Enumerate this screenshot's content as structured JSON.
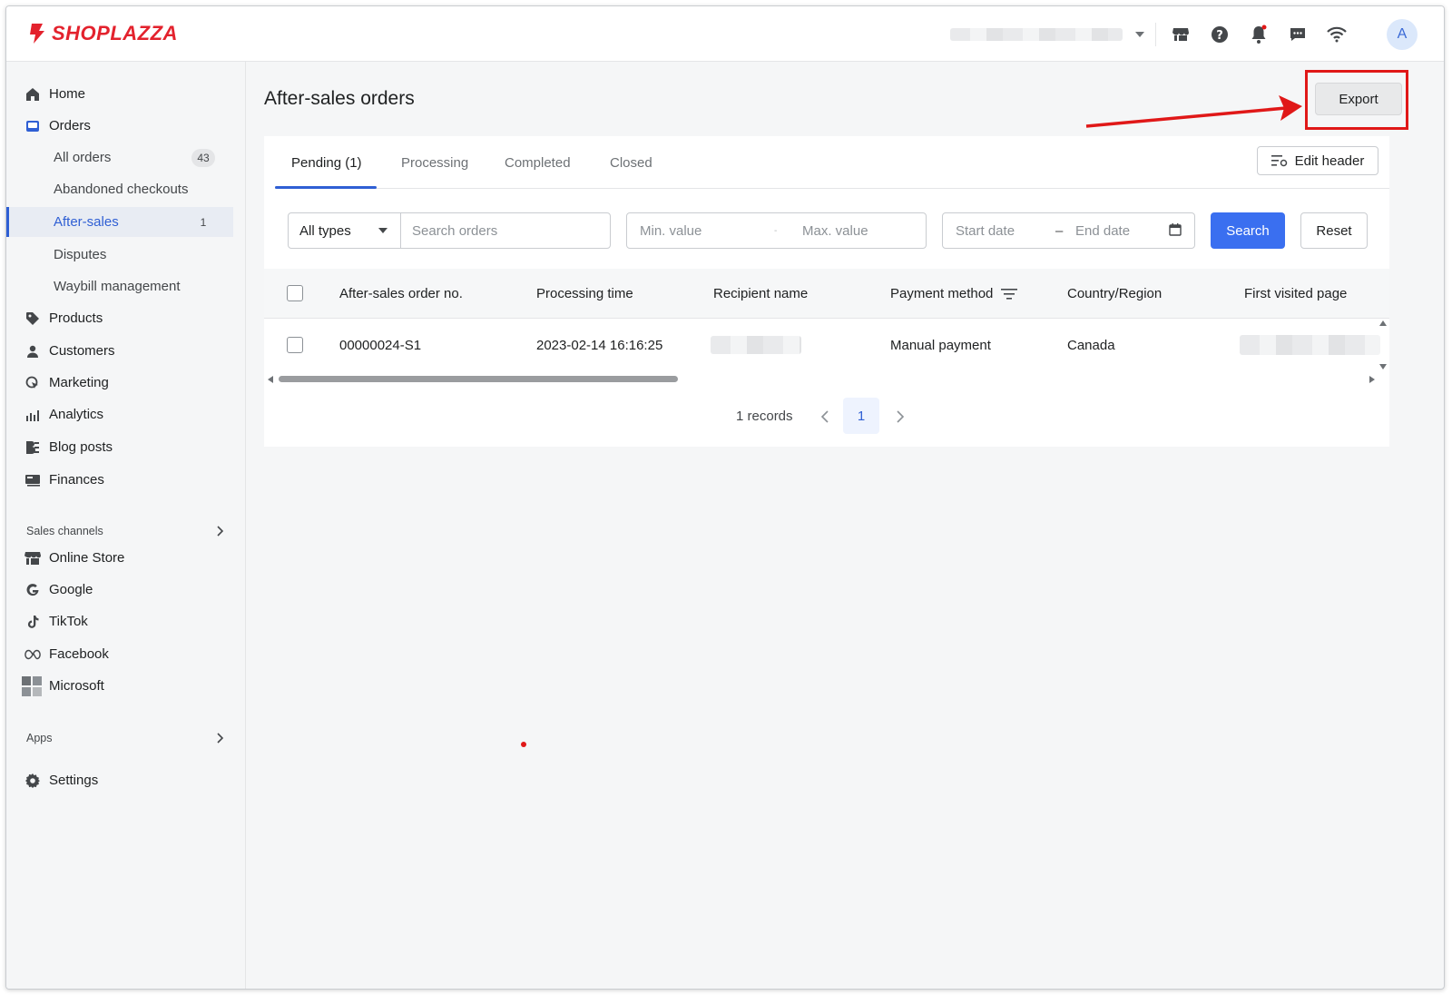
{
  "brand": {
    "name": "SHOPLAZZA",
    "color": "#e3222d"
  },
  "accent_color": "#2f5fd4",
  "topbar": {
    "avatar_letter": "A",
    "icons": [
      "store-icon",
      "help-icon",
      "bell-icon",
      "chat-icon",
      "wifi-icon"
    ]
  },
  "sidebar": {
    "items": [
      {
        "label": "Home",
        "icon": "home-icon"
      },
      {
        "label": "Orders",
        "icon": "orders-icon"
      },
      {
        "label": "Products",
        "icon": "tag-icon"
      },
      {
        "label": "Customers",
        "icon": "person-icon"
      },
      {
        "label": "Marketing",
        "icon": "marketing-icon"
      },
      {
        "label": "Analytics",
        "icon": "bar-chart-icon"
      },
      {
        "label": "Blog posts",
        "icon": "blog-icon"
      },
      {
        "label": "Finances",
        "icon": "finance-icon"
      }
    ],
    "order_sub": [
      {
        "label": "All orders",
        "badge": "43"
      },
      {
        "label": "Abandoned checkouts"
      },
      {
        "label": "After-sales",
        "badge": "1",
        "active": true
      },
      {
        "label": "Disputes"
      },
      {
        "label": "Waybill management"
      }
    ],
    "sales_channels_heading": "Sales channels",
    "channels": [
      {
        "label": "Online Store",
        "icon": "store-icon"
      },
      {
        "label": "Google",
        "icon": "google-icon"
      },
      {
        "label": "TikTok",
        "icon": "tiktok-icon"
      },
      {
        "label": "Facebook",
        "icon": "meta-icon"
      },
      {
        "label": "Microsoft",
        "icon": "microsoft-icon"
      }
    ],
    "apps_heading": "Apps",
    "settings": {
      "label": "Settings",
      "icon": "gear-icon"
    }
  },
  "main": {
    "title": "After-sales orders",
    "export_label": "Export",
    "tabs": [
      {
        "label": "Pending (1)",
        "active": true
      },
      {
        "label": "Processing"
      },
      {
        "label": "Completed"
      },
      {
        "label": "Closed"
      }
    ],
    "edit_header_label": "Edit header",
    "filters": {
      "type_select": "All types",
      "search_placeholder": "Search orders",
      "min_placeholder": "Min. value",
      "range_sep": "-",
      "max_placeholder": "Max. value",
      "start_date_placeholder": "Start date",
      "date_sep": "–",
      "end_date_placeholder": "End date",
      "search_label": "Search",
      "reset_label": "Reset"
    },
    "table": {
      "columns": [
        "After-sales order no.",
        "Processing time",
        "Recipient name",
        "Payment method",
        "Country/Region",
        "First visited page"
      ],
      "rows": [
        {
          "order_no": "00000024-S1",
          "processing_time": "2023-02-14 16:16:25",
          "payment_method": "Manual payment",
          "country": "Canada"
        }
      ]
    },
    "pagination": {
      "records": "1 records",
      "current_page": "1"
    }
  }
}
